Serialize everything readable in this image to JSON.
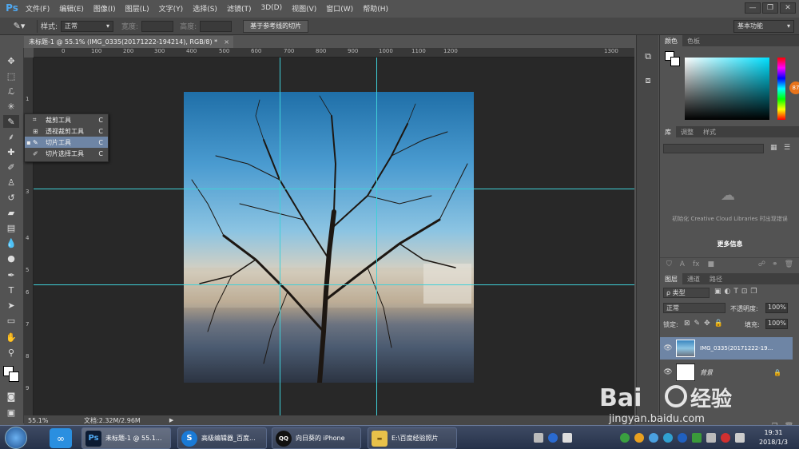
{
  "menubar": {
    "logo": "Ps",
    "items": [
      "文件(F)",
      "编辑(E)",
      "图像(I)",
      "图层(L)",
      "文字(Y)",
      "选择(S)",
      "滤镜(T)",
      "3D(D)",
      "视图(V)",
      "窗口(W)",
      "帮助(H)"
    ],
    "win_buttons": [
      "—",
      "❐",
      "✕"
    ]
  },
  "options": {
    "style_label": "样式:",
    "style_value": "正常",
    "width_label": "宽度:",
    "height_label": "高度:",
    "slice_button": "基于参考线的切片",
    "workspace": "基本功能"
  },
  "document": {
    "tab_title": "未标题-1 @ 55.1% (IMG_0335(20171222-194214), RGB/8) *",
    "ruler_top": [
      "0",
      "100",
      "200",
      "300",
      "400",
      "500",
      "600",
      "700",
      "800",
      "900",
      "1000",
      "1100",
      "1200",
      "1300"
    ],
    "ruler_left": [
      "1",
      "2",
      "3",
      "4",
      "5",
      "6",
      "7",
      "8",
      "9"
    ]
  },
  "status": {
    "zoom": "55.1%",
    "doc_size": "文档:2.32M/2.96M"
  },
  "flyout": {
    "items": [
      {
        "label": "裁剪工具",
        "key": "C",
        "selected": false
      },
      {
        "label": "透视裁剪工具",
        "key": "C",
        "selected": false
      },
      {
        "label": "切片工具",
        "key": "C",
        "selected": true
      },
      {
        "label": "切片选择工具",
        "key": "C",
        "selected": false
      }
    ]
  },
  "color_panel": {
    "tabs": [
      "颜色",
      "色板"
    ],
    "badge": "87"
  },
  "library_panel": {
    "tabs": [
      "库",
      "调整",
      "样式"
    ],
    "message": "初始化 Creative Cloud Libraries 时出现错误",
    "more_info": "更多信息"
  },
  "layers_panel": {
    "tabs": [
      "图层",
      "通道",
      "路径"
    ],
    "filter_label": "ρ 类型",
    "blend_mode": "正常",
    "opacity_label": "不透明度:",
    "opacity_value": "100%",
    "lock_label": "锁定:",
    "fill_label": "填充:",
    "fill_value": "100%",
    "layers": [
      {
        "name": "IMG_0335(20171222-19...",
        "selected": true
      },
      {
        "name": "背景",
        "selected": false
      }
    ]
  },
  "taskbar": {
    "items": [
      {
        "label": "未标题-1 @ 55.1...",
        "icon": "Ps"
      },
      {
        "label": "高级编辑器_百度...",
        "icon": "S"
      },
      {
        "label": "向日葵的 iPhone",
        "icon": "QQ"
      },
      {
        "label": "E:\\百度经验照片",
        "icon": "folder"
      }
    ],
    "time": "19:31",
    "date": "2018/1/3"
  },
  "watermark": "Baidu经验 jingyan.baidu.com",
  "colors": {
    "guide": "#3fd0d8",
    "accent": "#4fa8f0",
    "selection": "#6e85a5"
  }
}
